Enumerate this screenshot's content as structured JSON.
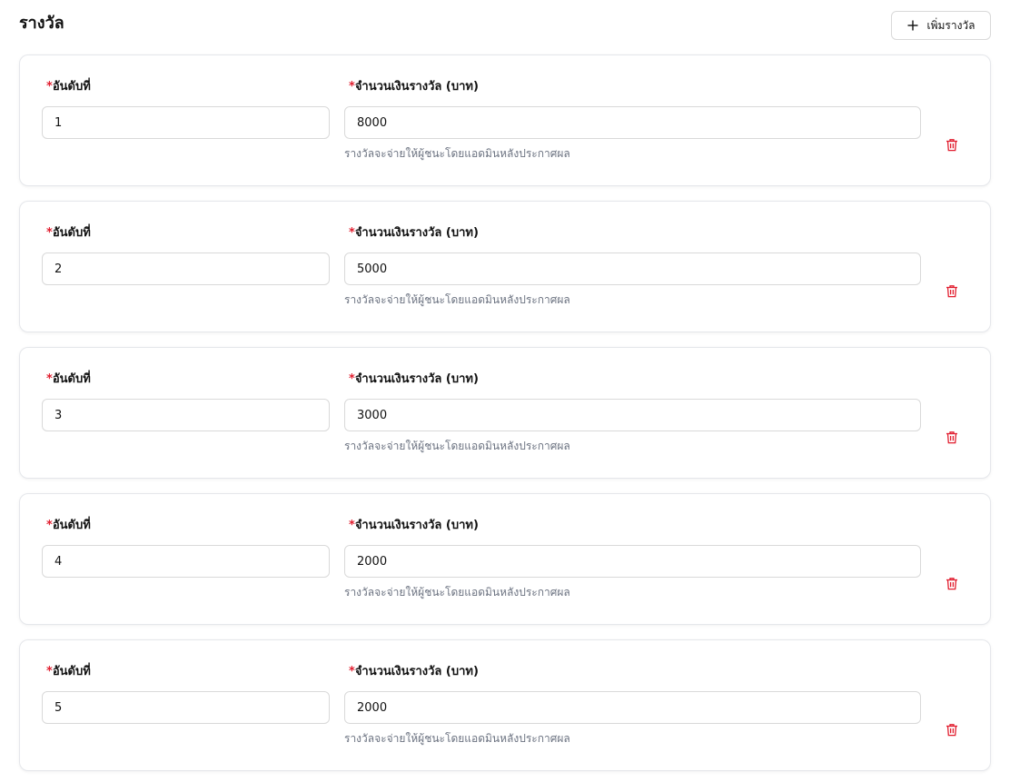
{
  "header": {
    "title": "รางวัล",
    "add_button_label": "เพิ่มรางวัล",
    "add_icon": "plus-icon"
  },
  "labels": {
    "required_mark": "*",
    "rank_label": "อันดับที่",
    "amount_label": "จำนวนเงินรางวัล (บาท)",
    "helper": "รางวัลจะจ่ายให้ผู้ชนะโดยแอดมินหลังประกาศผล"
  },
  "prizes": [
    {
      "rank": "1",
      "amount": "8000"
    },
    {
      "rank": "2",
      "amount": "5000"
    },
    {
      "rank": "3",
      "amount": "3000"
    },
    {
      "rank": "4",
      "amount": "2000"
    },
    {
      "rank": "5",
      "amount": "2000"
    }
  ],
  "colors": {
    "required": "#e11d2e",
    "delete_icon": "#e11d2e",
    "helper_text": "#6b7280",
    "border": "#d9d9d9"
  },
  "icons": {
    "delete": "trash-icon"
  }
}
